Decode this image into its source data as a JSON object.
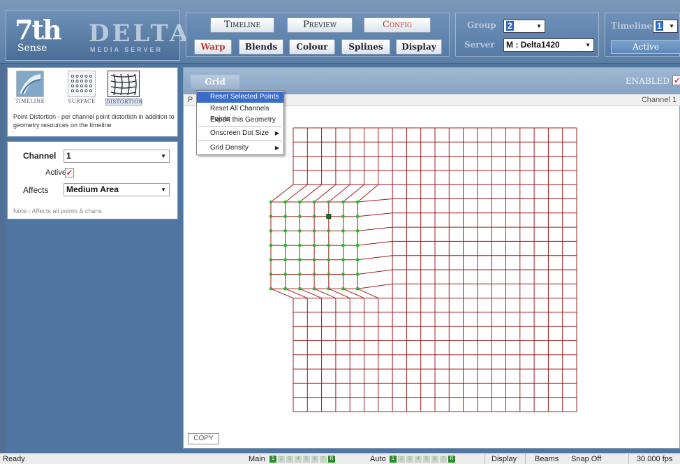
{
  "logo": {
    "brand_top": "7th",
    "brand_bottom": "Sense",
    "product": "DELTA",
    "tagline": "MEDIA SERVER"
  },
  "nav": {
    "primary": [
      "Timeline",
      "Preview",
      "Config"
    ],
    "primary_active": "Config",
    "secondary": [
      "Warp",
      "Blends",
      "Colour",
      "Splines",
      "Display"
    ],
    "secondary_active": "Warp"
  },
  "group": {
    "label": "Group",
    "value": "2"
  },
  "server": {
    "label": "Server",
    "value": "M : Delta1420"
  },
  "timeline": {
    "label": "Timeline",
    "value": "1",
    "status": "Active"
  },
  "tools": [
    {
      "label": "TIMELINE",
      "icon": "timeline-icon"
    },
    {
      "label": "SURFACE",
      "icon": "surface-dots-icon"
    },
    {
      "label": "DISTORTION",
      "icon": "distortion-grid-icon"
    }
  ],
  "tool_selected": "DISTORTION",
  "tool_description": "Point Distortion - per channel point distortion in addition to geometry resources on the timeline",
  "props": {
    "channel_label": "Channel",
    "channel_value": "1",
    "active_label": "Active",
    "active_checked": true,
    "affects_label": "Affects",
    "affects_value": "Medium Area",
    "note": "Note - Affects all points & chans"
  },
  "canvas": {
    "menu_label": "Grid",
    "enabled_label": "ENABLED",
    "enabled_checked": true,
    "sub_left": "P",
    "sub_right": "Channel 1",
    "copy_label": "COPY"
  },
  "context_menu": {
    "items": [
      {
        "label": "Reset Selected Points",
        "highlighted": true,
        "submenu": false
      },
      {
        "label": "Reset All Channels Points",
        "highlighted": false,
        "submenu": false
      },
      {
        "label": "Export this Geometry",
        "highlighted": false,
        "submenu": false
      },
      {
        "label": "Onscreen Dot Size",
        "highlighted": false,
        "submenu": true
      },
      {
        "label": "Grid Density",
        "highlighted": false,
        "submenu": true
      }
    ]
  },
  "status": {
    "ready": "Ready",
    "main_label": "Main",
    "auto_label": "Auto",
    "channels": [
      "1",
      "2",
      "3",
      "4",
      "5",
      "6",
      "7",
      "R"
    ],
    "main_on": [
      "1",
      "R"
    ],
    "auto_on": [
      "1",
      "R"
    ],
    "display": "Display",
    "beams": "Beams",
    "snap": "Snap Off",
    "fps": "30.000 fps"
  },
  "colors": {
    "grid_line": "#a01c1c",
    "control_point": "#22bb22",
    "selected_point": "#1a7a1a",
    "menu_highlight": "#3a6ccc",
    "active_nav": "#c0392b"
  }
}
